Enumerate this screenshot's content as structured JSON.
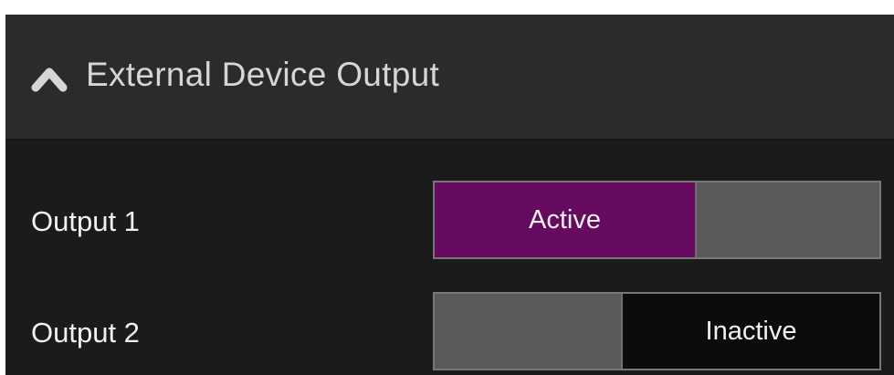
{
  "section": {
    "title": "External Device Output",
    "icon": "chevron-up-icon",
    "expanded": true
  },
  "outputs": [
    {
      "label": "Output 1",
      "state_label": "Active",
      "state": "active",
      "active_color": "#650a5e"
    },
    {
      "label": "Output 2",
      "state_label": "Inactive",
      "state": "inactive",
      "inactive_color": "#0c0c0c"
    }
  ],
  "colors": {
    "panel_bg": "#1b1b1b",
    "header_bg": "#2b2b2b",
    "toggle_off_segment": "#5a5a5a",
    "toggle_border": "#777777"
  }
}
